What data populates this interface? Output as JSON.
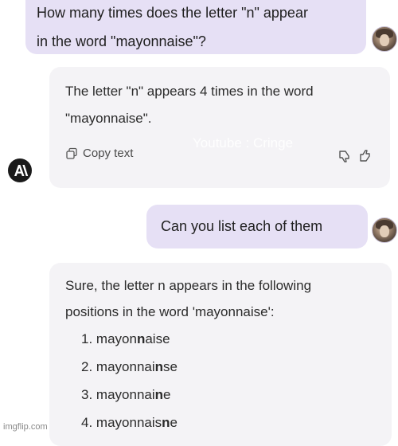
{
  "messages": {
    "user_1": {
      "line_1": "How many times does the letter \"n\" appear",
      "line_2": "in the word \"mayonnaise\"?"
    },
    "assistant_1": {
      "line_1": "The letter \"n\" appears 4 times in the word",
      "line_2": "\"mayonnaise\".",
      "copy_label": "Copy text"
    },
    "user_2": {
      "text": "Can you list each of them"
    },
    "assistant_2": {
      "line_1": "Sure, the letter n appears in the following",
      "line_2": "positions in the word 'mayonnaise':",
      "items": [
        {
          "num": "1.",
          "pre": "mayon",
          "bold": "n",
          "post": "aise"
        },
        {
          "num": "2.",
          "pre": "mayonnai",
          "bold": "n",
          "post": "se"
        },
        {
          "num": "3.",
          "pre": "mayonnai",
          "bold": "n",
          "post": "e"
        },
        {
          "num": "4.",
          "pre": "mayonnais",
          "bold": "n",
          "post": "e"
        }
      ]
    }
  },
  "watermarks": {
    "youtube": "Youtube : Cringe",
    "imgflip": "imgflip.com"
  },
  "icons": {
    "copy": "copy-icon",
    "thumbs_down": "thumbs-down-icon",
    "thumbs_up": "thumbs-up-icon",
    "assistant_logo": "anthropic-logo-icon",
    "user_avatar": "user-avatar"
  },
  "colors": {
    "user_bubble": "#e6e0f5",
    "assistant_card": "#f4f3f6",
    "logo_bg": "#1a1a1a"
  }
}
